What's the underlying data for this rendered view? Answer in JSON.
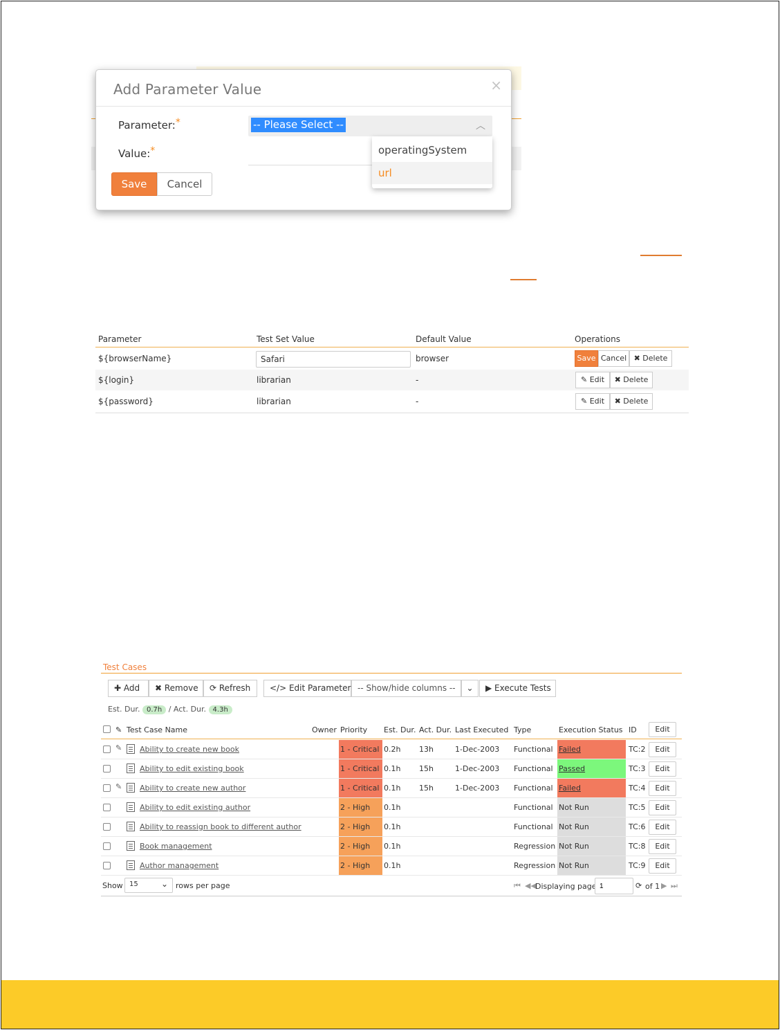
{
  "modal": {
    "title": "Add Parameter Value",
    "close": "×",
    "parameter_label": "Parameter:",
    "value_label": "Value:",
    "required_mark": "*",
    "select_value": "-- Please Select --",
    "dropdown_options": [
      "operatingSystem",
      "url"
    ],
    "save_label": "Save",
    "cancel_label": "Cancel"
  },
  "param_table": {
    "headers": [
      "Parameter",
      "Test Set Value",
      "Default Value",
      "Operations"
    ],
    "rows": [
      {
        "parameter": "${browserName}",
        "test_set_value": "Safari",
        "default_value": "browser"
      },
      {
        "parameter": "${login}",
        "test_set_value": "librarian",
        "default_value": "-"
      },
      {
        "parameter": "${password}",
        "test_set_value": "librarian",
        "default_value": "-"
      }
    ],
    "save_label": "Save",
    "cancel_label": "Cancel",
    "edit_label": "Edit",
    "delete_label": "Delete"
  },
  "test_cases": {
    "title": "Test Cases",
    "toolbar": {
      "add": "Add",
      "remove": "Remove",
      "refresh": "Refresh",
      "edit_parameters": "Edit Parameters",
      "show_hide": "-- Show/hide columns --",
      "execute": "Execute Tests"
    },
    "est_dur_label": "Est. Dur.",
    "est_dur_value": "0.7h",
    "act_dur_label": "/ Act. Dur.",
    "act_dur_value": "4.3h",
    "columns": [
      "Test Case Name",
      "Owner",
      "Priority",
      "Est. Dur.",
      "Act. Dur.",
      "Last Executed",
      "Type",
      "Execution Status",
      "ID",
      "Edit"
    ],
    "rows": [
      {
        "name": "Ability to create new book",
        "priority": "1 - Critical",
        "est": "0.2h",
        "act": "13h",
        "last": "1-Dec-2003",
        "type": "Functional",
        "status": "Failed",
        "id": "TC:2",
        "attach": true
      },
      {
        "name": "Ability to edit existing book",
        "priority": "1 - Critical",
        "est": "0.1h",
        "act": "15h",
        "last": "1-Dec-2003",
        "type": "Functional",
        "status": "Passed",
        "id": "TC:3",
        "attach": false
      },
      {
        "name": "Ability to create new author",
        "priority": "1 - Critical",
        "est": "0.1h",
        "act": "15h",
        "last": "1-Dec-2003",
        "type": "Functional",
        "status": "Failed",
        "id": "TC:4",
        "attach": true
      },
      {
        "name": "Ability to edit existing author",
        "priority": "2 - High",
        "est": "0.1h",
        "act": "",
        "last": "",
        "type": "Functional",
        "status": "Not Run",
        "id": "TC:5",
        "attach": false
      },
      {
        "name": "Ability to reassign book to different author",
        "priority": "2 - High",
        "est": "0.1h",
        "act": "",
        "last": "",
        "type": "Functional",
        "status": "Not Run",
        "id": "TC:6",
        "attach": false
      },
      {
        "name": "Book management",
        "priority": "2 - High",
        "est": "0.1h",
        "act": "",
        "last": "",
        "type": "Regression",
        "status": "Not Run",
        "id": "TC:8",
        "attach": false
      },
      {
        "name": "Author management",
        "priority": "2 - High",
        "est": "0.1h",
        "act": "",
        "last": "",
        "type": "Regression",
        "status": "Not Run",
        "id": "TC:9",
        "attach": false
      }
    ],
    "edit_label": "Edit",
    "footer": {
      "show": "Show",
      "rows_value": "15",
      "rows_per_page": "rows per page",
      "displaying_page": "Displaying page",
      "page_value": "1",
      "of": "of 1"
    }
  },
  "colors": {
    "accent": "#f0803c",
    "critical": "#f27a5e",
    "high": "#f6a15a",
    "passed": "#7cf77c",
    "notrun": "#dddddd",
    "footer_band": "#fccb28"
  }
}
